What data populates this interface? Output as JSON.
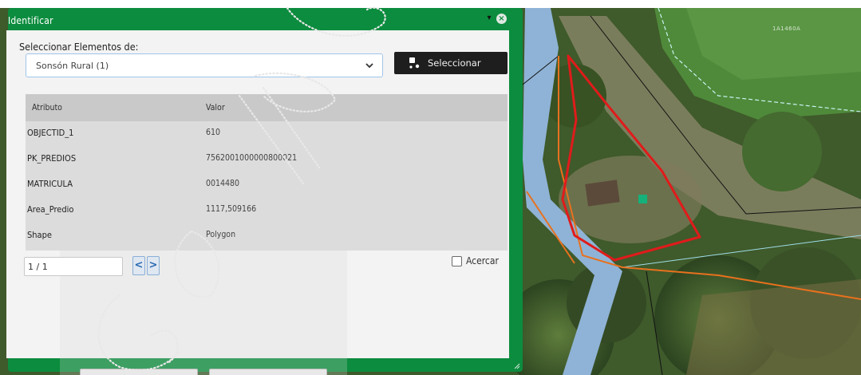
{
  "map": {
    "label": "1A1460A",
    "colors": {
      "vegetation": "#3f5a2b",
      "road": "#8fb3d6",
      "parcel_outline": "#e01b1b",
      "boundary": "#e8711e"
    }
  },
  "dialog": {
    "title": "Identificar",
    "minimize_icon": "chevron-down-icon",
    "close_icon": "close-circle-icon",
    "select_label": "Seleccionar Elementos de:",
    "source_value": "Sonsón Rural (1)",
    "select_button_label": "Seleccionar",
    "table": {
      "headers": [
        "Atributo",
        "Valor"
      ],
      "rows": [
        {
          "key": "OBJECTID_1",
          "value": "610"
        },
        {
          "key": "PK_PREDIOS",
          "value": "7562001000000800021"
        },
        {
          "key": "MATRICULA",
          "value": "0014480"
        },
        {
          "key": "Area_Predio",
          "value": "1117,509166"
        },
        {
          "key": "Shape",
          "value": "Polygon"
        }
      ]
    },
    "pager": {
      "value": "1 / 1",
      "prev": "<",
      "next": ">"
    },
    "zoom_label": "Acercar",
    "accent": "#0c8c3e"
  }
}
